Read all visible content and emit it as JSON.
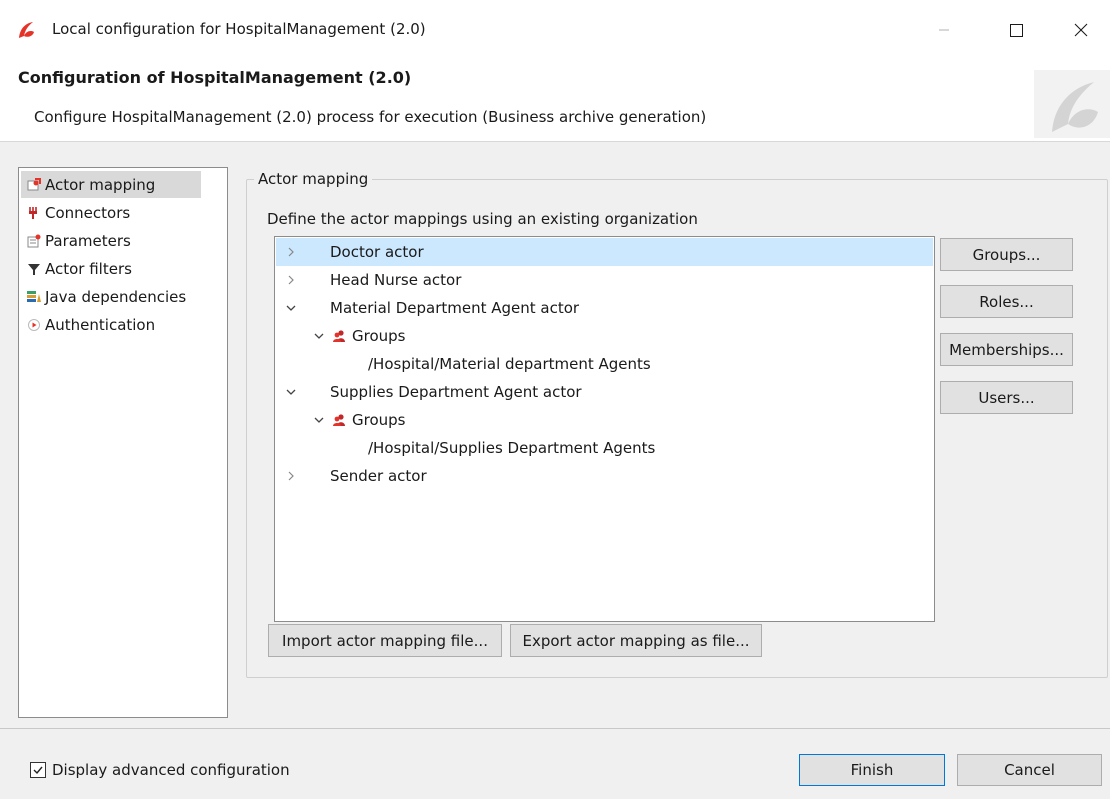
{
  "window": {
    "title": "Local configuration for HospitalManagement (2.0)",
    "app_icon": "bonita-logo-icon"
  },
  "header": {
    "title": "Configuration of HospitalManagement (2.0)",
    "subtitle": "Configure HospitalManagement (2.0) process for execution (Business archive generation)"
  },
  "nav": {
    "items": [
      {
        "label": "Actor mapping",
        "icon": "actor-mapping-icon",
        "selected": true
      },
      {
        "label": "Connectors",
        "icon": "connector-icon",
        "selected": false
      },
      {
        "label": "Parameters",
        "icon": "parameters-icon",
        "selected": false
      },
      {
        "label": "Actor filters",
        "icon": "filter-icon",
        "selected": false
      },
      {
        "label": "Java dependencies",
        "icon": "java-dependencies-icon",
        "selected": false
      },
      {
        "label": "Authentication",
        "icon": "authentication-icon",
        "selected": false
      }
    ]
  },
  "actor_mapping": {
    "group_title": "Actor mapping",
    "instructions": "Define the actor mappings using an existing organization",
    "tree": [
      {
        "label": "Doctor actor",
        "expanded": false,
        "selected": true
      },
      {
        "label": "Head Nurse actor",
        "expanded": false,
        "selected": false
      },
      {
        "label": "Material Department Agent actor",
        "expanded": true,
        "selected": false
      },
      {
        "label": "Groups",
        "expanded": true,
        "selected": false
      },
      {
        "label": "/Hospital/Material department Agents",
        "selected": false
      },
      {
        "label": "Supplies Department Agent actor",
        "expanded": true,
        "selected": false
      },
      {
        "label": "Groups",
        "expanded": true,
        "selected": false
      },
      {
        "label": "/Hospital/Supplies Department Agents",
        "selected": false
      },
      {
        "label": "Sender actor",
        "expanded": false,
        "selected": false
      }
    ],
    "side_buttons": {
      "groups": "Groups...",
      "roles": "Roles...",
      "memberships": "Memberships...",
      "users": "Users..."
    },
    "import_button": "Import actor mapping file...",
    "export_button": "Export actor mapping as file..."
  },
  "footer": {
    "advanced_label": "Display advanced configuration",
    "advanced_checked": true,
    "finish": "Finish",
    "cancel": "Cancel"
  },
  "colors": {
    "accent_red": "#e5332a",
    "selection_blue": "#cce8ff",
    "panel_bg": "#f0f0f0"
  }
}
